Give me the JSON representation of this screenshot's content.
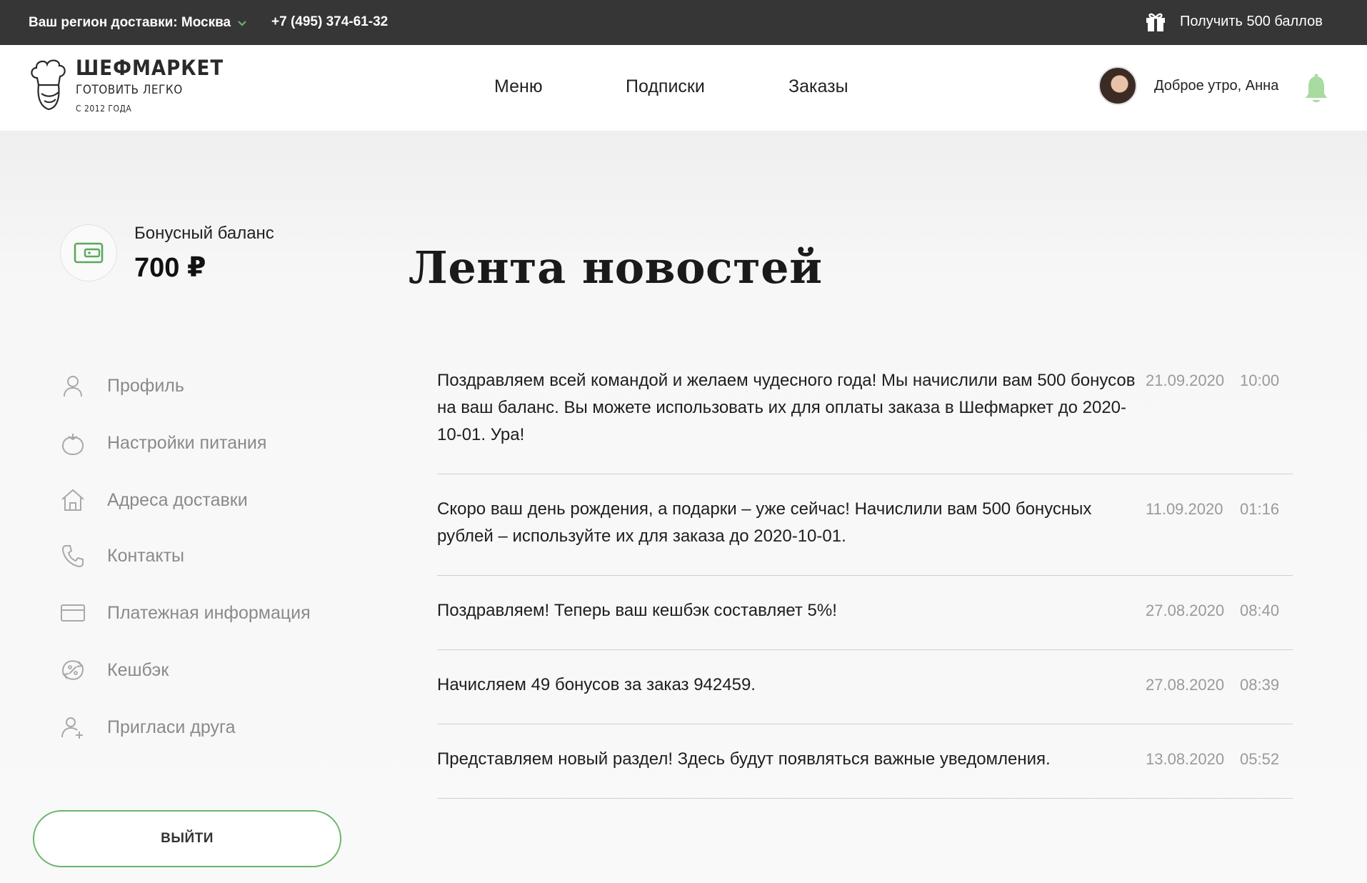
{
  "topbar": {
    "region_label": "Ваш регион доставки: Москва",
    "phone": "+7 (495) 374-61-32",
    "promo_label": "Получить 500 баллов"
  },
  "logo": {
    "name": "ШЕФМАРКЕТ",
    "slogan": "ГОТОВИТЬ ЛЕГКО",
    "since": "С 2012 ГОДА"
  },
  "nav": {
    "items": [
      {
        "label": "Меню"
      },
      {
        "label": "Подписки"
      },
      {
        "label": "Заказы"
      }
    ]
  },
  "user": {
    "greeting": "Доброе утро, Анна"
  },
  "bonus": {
    "label": "Бонусный баланс",
    "value": "700 ₽"
  },
  "page": {
    "title": "Лента новостей"
  },
  "sidebar": {
    "items": [
      {
        "label": "Профиль",
        "icon": "user-icon"
      },
      {
        "label": "Настройки питания",
        "icon": "tomato-icon"
      },
      {
        "label": "Адреса доставки",
        "icon": "house-icon"
      },
      {
        "label": "Контакты",
        "icon": "phone-icon"
      },
      {
        "label": "Платежная информация",
        "icon": "card-icon"
      },
      {
        "label": "Кешбэк",
        "icon": "cashback-icon"
      },
      {
        "label": "Пригласи друга",
        "icon": "add-user-icon"
      }
    ],
    "logout_label": "ВЫЙТИ"
  },
  "feed": {
    "items": [
      {
        "text": "Поздравляем всей командой и желаем чудесного года! Мы начислили вам 500 бонусов на ваш баланс. Вы можете использовать их для оплаты заказа в Шефмаркет до 2020-10-01. Ура!",
        "date": "21.09.2020",
        "time": "10:00"
      },
      {
        "text": "Скоро ваш день рождения, а подарки – уже сейчас! Начислили вам 500 бонусных рублей – используйте их для заказа до 2020-10-01.",
        "date": "11.09.2020",
        "time": "01:16"
      },
      {
        "text": "Поздравляем! Теперь ваш кешбэк составляет 5%!",
        "date": "27.08.2020",
        "time": "08:40"
      },
      {
        "text": "Начисляем 49 бонусов за заказ 942459.",
        "date": "27.08.2020",
        "time": "08:39"
      },
      {
        "text": "Представляем новый раздел! Здесь будут появляться важные уведомления.",
        "date": "13.08.2020",
        "time": "05:52"
      }
    ]
  },
  "colors": {
    "accent": "#6ab56a",
    "topbar": "#363636",
    "muted_text": "#8a8a8a"
  }
}
